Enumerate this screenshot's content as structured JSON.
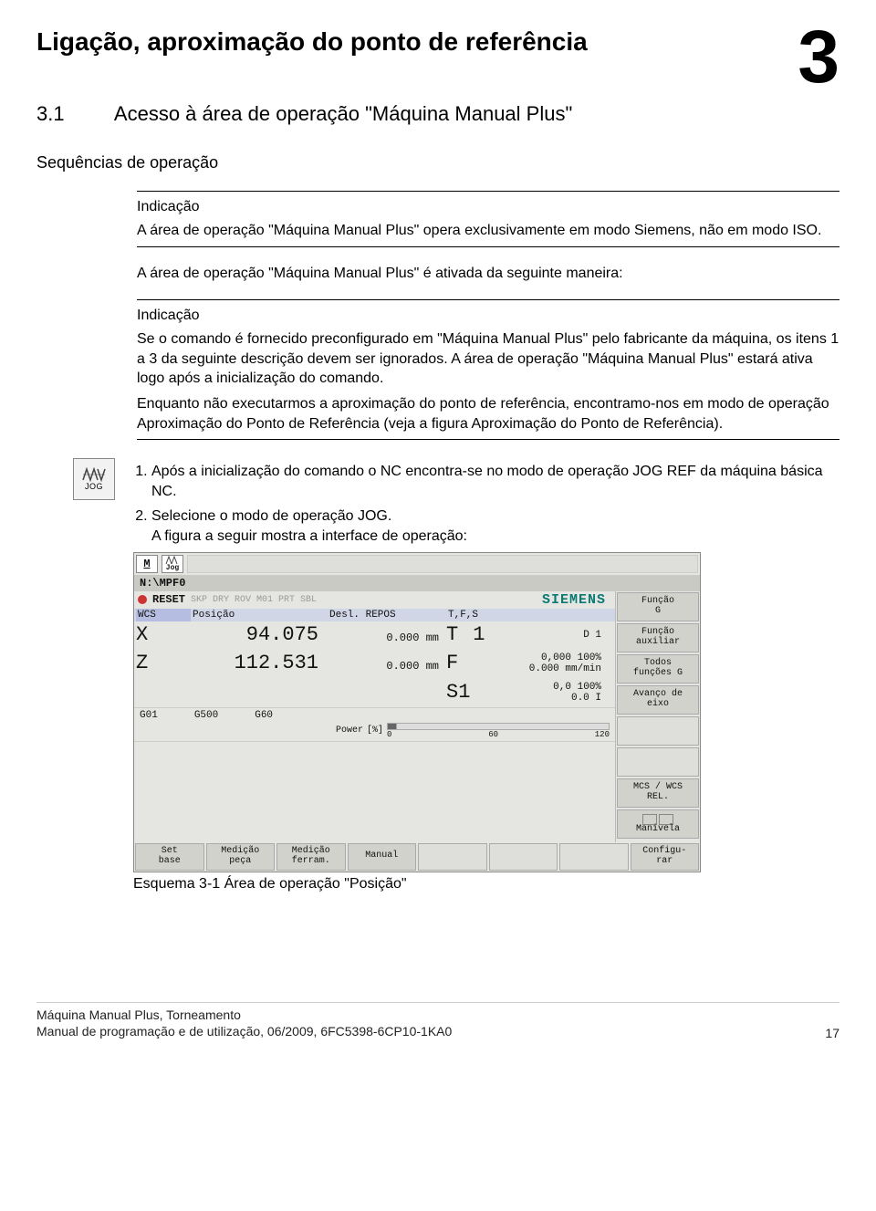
{
  "chapter_number": "3",
  "title": "Ligação, aproximação do ponto de referência",
  "section": {
    "number": "3.1",
    "heading": "Acesso à área de operação \"Máquina Manual Plus\""
  },
  "sequence_label": "Sequências de operação",
  "note1": {
    "label": "Indicação",
    "body": "A área de operação \"Máquina Manual Plus\" opera exclusivamente em modo Siemens, não em modo ISO."
  },
  "para1": "A área de operação \"Máquina Manual Plus\" é ativada da seguinte maneira:",
  "note2": {
    "label": "Indicação",
    "body1": "Se o comando é fornecido preconfigurado em \"Máquina Manual Plus\" pelo fabricante da máquina, os itens 1 a 3 da seguinte descrição devem ser ignorados. A área de operação \"Máquina Manual Plus\" estará ativa logo após a inicialização do comando.",
    "body2": "Enquanto não executarmos a aproximação do ponto de referência, encontramo-nos em modo de operação Aproximação do Ponto de Referência (veja a figura Aproximação do Ponto de Referência)."
  },
  "jog_icon_label": "JOG",
  "steps": {
    "s1": "Após a inicialização do comando o NC encontra-se no modo de operação JOG REF da máquina básica NC.",
    "s2a": "Selecione o modo de operação JOG.",
    "s2b": "A figura a seguir mostra a interface de operação:"
  },
  "screenshot_caption": "Esquema 3-1 Área de operação \"Posição\"",
  "nc": {
    "top_icon1": "M",
    "top_mode": "Jog",
    "program": "N:\\MPF0",
    "reset": "RESET",
    "status_tokens": "SKP DRY  ROV  M01 PRT SBL",
    "brand": "SIEMENS",
    "hdr_wcs": "WCS",
    "hdr_pos": "Posição",
    "hdr_desl": "Desl. REPOS",
    "hdr_tfs": "T,F,S",
    "ax_x": "X",
    "pos_x": "94.075",
    "desl_x": "0.000 mm",
    "t_label": "T",
    "t_value": "1",
    "t_d": "D 1",
    "ax_z": "Z",
    "pos_z": "112.531",
    "desl_z": "0.000 mm",
    "f_label": "F",
    "f_val1": "0,000",
    "f_pct": "100%",
    "f_val2": "0.000",
    "f_unit": "mm/min",
    "s_label": "S1",
    "s_val1": "0,0",
    "s_pct": "100%",
    "s_val2": "0.0",
    "s_unit": "I",
    "g1": "G01",
    "g2": "G500",
    "g3": "G60",
    "power_label": "Power",
    "power_unit": "[%]",
    "power_ticks": [
      "0",
      "60",
      "120"
    ],
    "side": {
      "b1a": "Função",
      "b1b": "G",
      "b2a": "Função",
      "b2b": "auxiliar",
      "b3a": "Todos",
      "b3b": "funções G",
      "b4a": "Avanço de",
      "b4b": "eixo",
      "b7a": "MCS / WCS",
      "b7b": "REL.",
      "b8": "Manivela"
    },
    "bottom": {
      "b1a": "Set",
      "b1b": "base",
      "b2a": "Medição",
      "b2b": "peça",
      "b3a": "Medição",
      "b3b": "ferram.",
      "b4": "Manual",
      "b8a": "Configu-",
      "b8b": "rar"
    }
  },
  "footer": {
    "line1": "Máquina Manual Plus, Torneamento",
    "line2": "Manual de programação e de utilização, 06/2009, 6FC5398-6CP10-1KA0",
    "page": "17"
  }
}
